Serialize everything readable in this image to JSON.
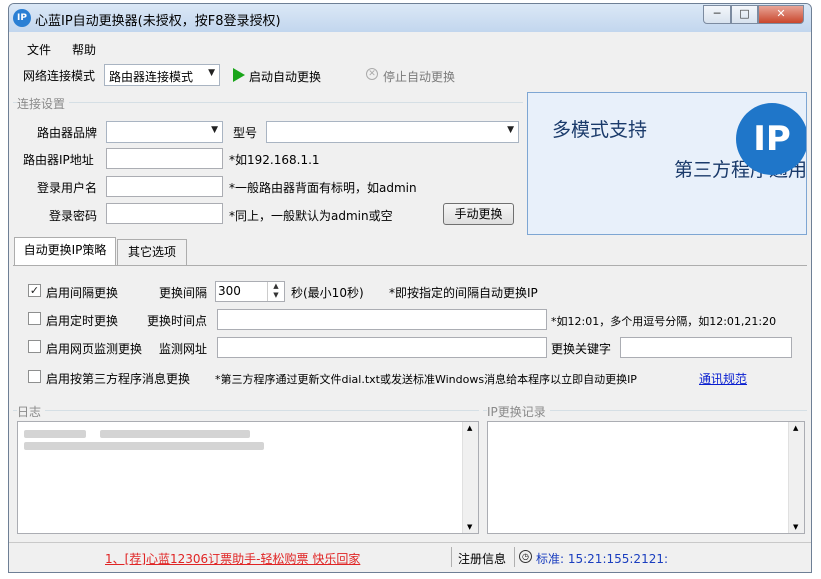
{
  "window": {
    "title": "心蓝IP自动更换器(未授权，按F8登录授权)",
    "logo_text": "IP",
    "buttons": {
      "minimize": "─",
      "maximize": "□",
      "close": "✕"
    }
  },
  "menu": {
    "file": "文件",
    "help": "帮助"
  },
  "toolbar": {
    "mode_label": "网络连接模式",
    "mode_value": "路由器连接模式",
    "start_label": "启动自动更换",
    "stop_label": "停止自动更换"
  },
  "connection": {
    "group_title": "连接设置",
    "brand_label": "路由器品牌",
    "brand_value": "",
    "model_label": "型号",
    "model_value": "",
    "ip_label": "路由器IP地址",
    "ip_value": "",
    "ip_hint": "*如192.168.1.1",
    "user_label": "登录用户名",
    "user_value": "",
    "user_hint": "*一般路由器背面有标明，如admin",
    "pass_label": "登录密码",
    "pass_value": "",
    "pass_hint": "*同上，一般默认为admin或空",
    "manual_button": "手动更换"
  },
  "banner": {
    "heading": "多模式支持",
    "subheading": "第三方程序通用",
    "logo_text": "IP"
  },
  "tabs": [
    {
      "label": "自动更换IP策略",
      "active": true
    },
    {
      "label": "其它选项",
      "active": false
    }
  ],
  "strategy": {
    "interval": {
      "checked": true,
      "label": "启用间隔更换",
      "field_label": "更换间隔",
      "value": "300",
      "unit": "秒(最小10秒)",
      "hint": "*即按指定的间隔自动更换IP"
    },
    "timed": {
      "checked": false,
      "label": "启用定时更换",
      "field_label": "更换时间点",
      "value": "",
      "hint": "*如12:01，多个用逗号分隔，如12:01,21:20"
    },
    "web": {
      "checked": false,
      "label": "启用网页监测更换",
      "field_label": "监测网址",
      "value": "",
      "keyword_label": "更换关键字",
      "keyword_value": ""
    },
    "third_party": {
      "checked": false,
      "label": "启用按第三方程序消息更换",
      "hint": "*第三方程序通过更新文件dial.txt或发送标准Windows消息给本程序以立即自动更换IP",
      "link": "通讯规范"
    }
  },
  "log": {
    "title": "日志"
  },
  "ip_history": {
    "title": "IP更换记录"
  },
  "status": {
    "ad_link": "1、[荐]心蓝12306订票助手-轻松购票 快乐回家",
    "register_label": "注册信息",
    "time_text": "标准: 15:21:155:2121:"
  },
  "icons": {
    "start": "play-icon",
    "stop": "stop-icon",
    "clock": "clock-icon",
    "combo_arrow": "chevron-down-icon"
  },
  "colors": {
    "window_bg": "#f0f0f0",
    "banner_bg": "#e8f0fa",
    "start_green": "#1aa51a",
    "link_blue": "#0a1fd0",
    "ad_red": "#e02424"
  }
}
